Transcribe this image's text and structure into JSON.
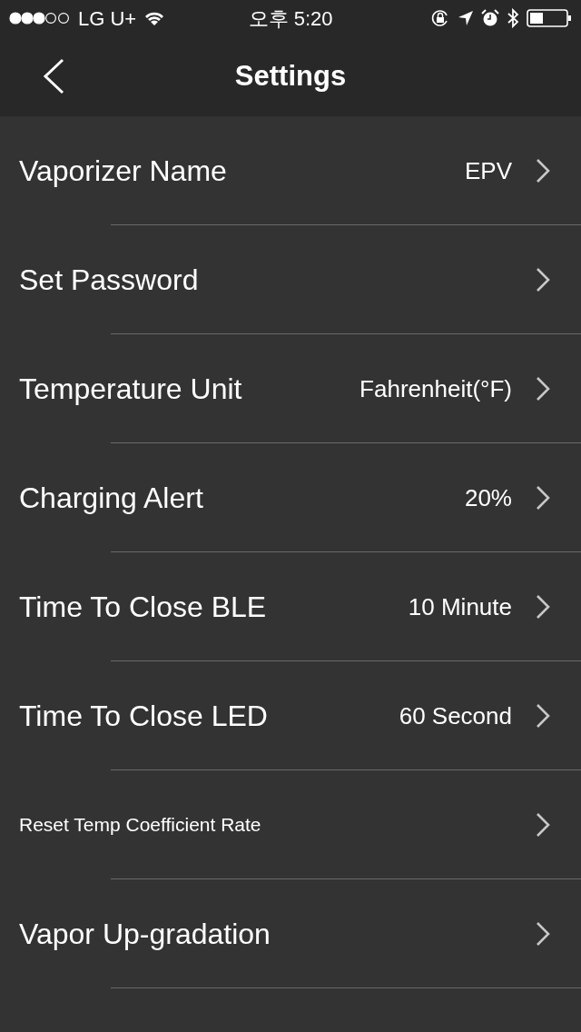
{
  "status_bar": {
    "carrier": "LG U+",
    "time": "오후 5:20"
  },
  "nav_bar": {
    "title": "Settings"
  },
  "settings": [
    {
      "kind": "normal",
      "label": "Vaporizer Name",
      "value": "EPV"
    },
    {
      "kind": "normal",
      "label": "Set Password"
    },
    {
      "kind": "normal",
      "label": "Temperature Unit",
      "value": "Fahrenheit(°F)"
    },
    {
      "kind": "normal",
      "label": "Charging Alert",
      "value": "20%"
    },
    {
      "kind": "normal",
      "label": "Time To Close BLE",
      "value": "10 Minute"
    },
    {
      "kind": "normal",
      "label": "Time To Close LED",
      "value": "60 Second"
    },
    {
      "kind": "small",
      "label": "Reset Temp Coefficient Rate"
    },
    {
      "kind": "normal",
      "label": "Vapor Up-gradation"
    }
  ]
}
